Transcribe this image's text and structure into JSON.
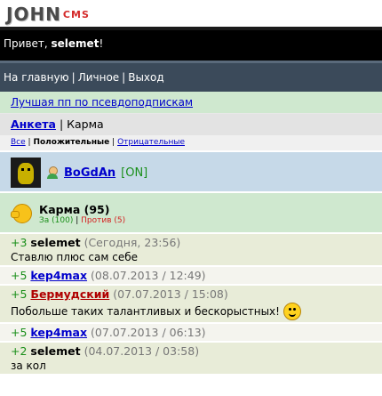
{
  "logo": {
    "john": "JOHN",
    "cms": "CMS"
  },
  "greeting": {
    "prefix": "Привет, ",
    "user": "selemet",
    "suffix": "!"
  },
  "nav": {
    "home": "На главную",
    "personal": "Личное",
    "logout": "Выход",
    "sep": "|"
  },
  "ad": {
    "text": "Лучшая пп по псевдоподпискам"
  },
  "tabs": {
    "profile": "Анкета",
    "sep": "|",
    "karma": "Карма"
  },
  "filter": {
    "all": "Все",
    "positive": "Положительные",
    "negative": "Отрицательные",
    "sep": "|"
  },
  "user": {
    "name": "BoGdAn",
    "status": "[ON]"
  },
  "karma": {
    "title": "Карма (95)",
    "for": "За (100)",
    "sep": "|",
    "against": "Против (5)"
  },
  "entries": [
    {
      "points": "+3",
      "user": "selemet",
      "time": "(Сегодня, 23:56)",
      "comment": "Ставлю плюс сам себе"
    },
    {
      "points": "+5",
      "user": "kep4max",
      "time": "(08.07.2013 / 12:49)"
    },
    {
      "points": "+5",
      "user": "Бермудский",
      "time": "(07.07.2013 / 15:08)",
      "comment": "Побольше таких талантливых и бескорыстных!"
    },
    {
      "points": "+5",
      "user": "kep4max",
      "time": "(07.07.2013 / 06:13)"
    },
    {
      "points": "+2",
      "user": "selemet",
      "time": "(04.07.2013 / 03:58)",
      "comment": "за кол"
    }
  ],
  "colors": {
    "accent": "#0000cc",
    "positive": "#1a8f1a",
    "negative": "#d42020"
  },
  "icons": [
    "user-icon",
    "karma-icon",
    "smiley-icon"
  ]
}
